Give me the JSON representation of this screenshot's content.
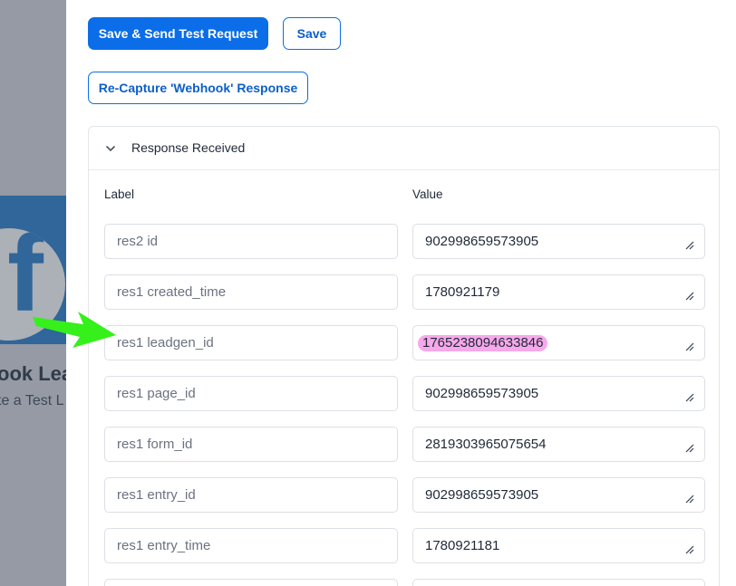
{
  "background_page": {
    "title_fragment": "ook Lea",
    "subtitle_fragment": "te a Test L",
    "logo_icon": "facebook-icon",
    "logo_color": "#1e78c8"
  },
  "toolbar": {
    "save_send_label": "Save & Send Test Request",
    "save_label": "Save",
    "recapture_label": "Re-Capture 'Webhook' Response"
  },
  "response": {
    "title": "Response Received",
    "toggle_icon": "chevron-down-icon",
    "label_header": "Label",
    "value_header": "Value",
    "rows": [
      {
        "label": "res2 id",
        "value": "902998659573905"
      },
      {
        "label": "res1 created_time",
        "value": "1780921179"
      },
      {
        "label": "res1 leadgen_id",
        "value": "1765238094633846"
      },
      {
        "label": "res1 page_id",
        "value": "902998659573905"
      },
      {
        "label": "res1 form_id",
        "value": "2819303965075654"
      },
      {
        "label": "res1 entry_id",
        "value": "902998659573905"
      },
      {
        "label": "res1 entry_time",
        "value": "1780921181"
      },
      {
        "label": "",
        "value": ""
      }
    ]
  },
  "annotation": {
    "icon": "green-arrow-icon",
    "color": "#35f01a",
    "highlight_color": "#f7a8ea"
  },
  "colors": {
    "primary": "#0b6ee8",
    "border": "#dcdfe4"
  }
}
